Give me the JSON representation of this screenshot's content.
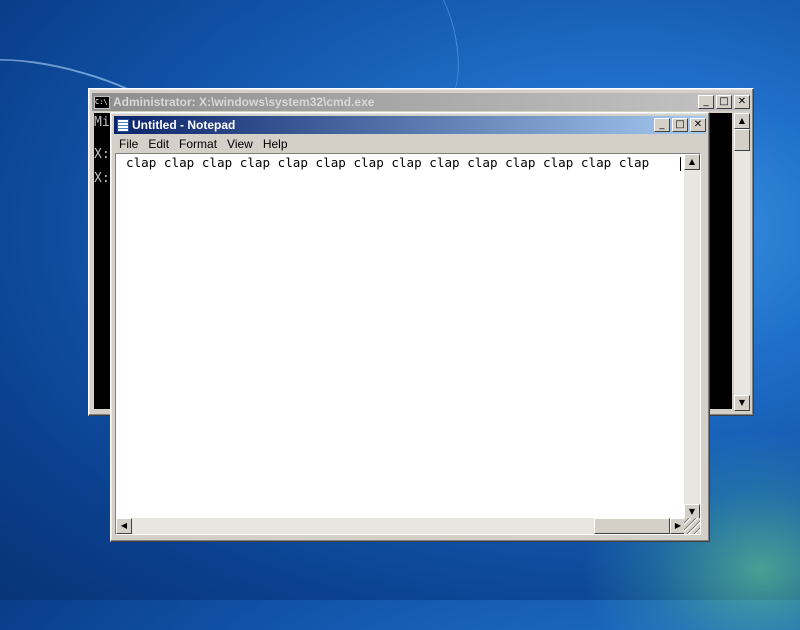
{
  "desktop": {
    "colors": {
      "background": "#1254aa",
      "accent_glow": "#78e68c"
    }
  },
  "cmd_window": {
    "title": "Administrator: X:\\windows\\system32\\cmd.exe",
    "icon_text": "C:\\",
    "lines": [
      "Mi",
      "",
      "X:",
      "",
      "X:"
    ],
    "buttons": {
      "minimize": "_",
      "maximize": "□",
      "close": "✕"
    }
  },
  "notepad": {
    "title": "Untitled - Notepad",
    "menu": [
      "File",
      "Edit",
      "Format",
      "View",
      "Help"
    ],
    "text": "clap clap clap clap clap clap clap clap clap clap clap clap clap clap",
    "buttons": {
      "minimize": "_",
      "maximize": "□",
      "close": "✕"
    },
    "scroll_arrows": {
      "up": "▲",
      "down": "▼",
      "left": "◀",
      "right": "▶"
    }
  }
}
